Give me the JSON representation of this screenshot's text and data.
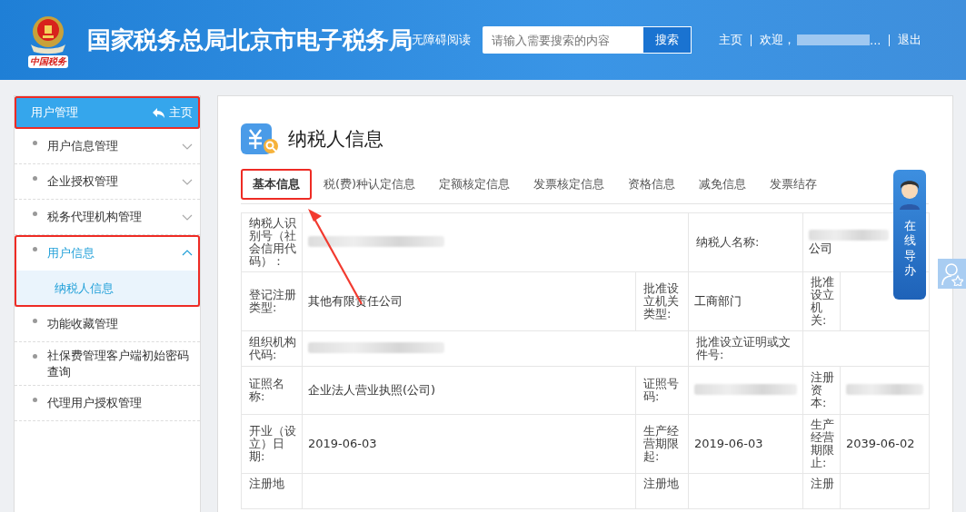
{
  "header": {
    "emblem_caption": "中国税务",
    "title": "国家税务总局北京市电子税务局",
    "accessibility": "无障碍阅读",
    "search": {
      "placeholder": "请输入需要搜索的内容",
      "button": "搜索"
    },
    "home": "主页",
    "welcome": "欢迎，",
    "ellipsis": "...",
    "logout": "退出"
  },
  "sidebar": {
    "title": "用户管理",
    "home": "主页",
    "items": [
      {
        "label": "用户信息管理",
        "kind": "group",
        "expanded": false
      },
      {
        "label": "企业授权管理",
        "kind": "group",
        "expanded": false
      },
      {
        "label": "税务代理机构管理",
        "kind": "group",
        "expanded": false
      },
      {
        "label": "用户信息",
        "kind": "group",
        "expanded": true,
        "children": [
          {
            "label": "纳税人信息",
            "selected": true
          }
        ]
      },
      {
        "label": "功能收藏管理",
        "kind": "link"
      },
      {
        "label": "社保费管理客户端初始密码查询",
        "kind": "link"
      },
      {
        "label": "代理用户授权管理",
        "kind": "link"
      }
    ]
  },
  "page": {
    "title": "纳税人信息",
    "tabs": [
      {
        "label": "基本信息",
        "selected": true
      },
      {
        "label": "税(费)种认定信息",
        "selected": false
      },
      {
        "label": "定额核定信息",
        "selected": false
      },
      {
        "label": "发票核定信息",
        "selected": false
      },
      {
        "label": "资格信息",
        "selected": false
      },
      {
        "label": "减免信息",
        "selected": false
      },
      {
        "label": "发票结存",
        "selected": false
      }
    ],
    "rows": [
      [
        {
          "kind": "label",
          "text": "纳税人识别号（社会信用代码）："
        },
        {
          "kind": "redacted",
          "colspan": 2
        },
        {
          "kind": "label",
          "text": "纳税人名称:"
        },
        {
          "kind": "partly_redacted",
          "text": "公司",
          "colspan": 2
        }
      ],
      [
        {
          "kind": "label",
          "text": "登记注册类型:"
        },
        {
          "kind": "value",
          "text": "其他有限责任公司"
        },
        {
          "kind": "label",
          "text": "批准设立机关类型:"
        },
        {
          "kind": "value",
          "text": "工商部门"
        },
        {
          "kind": "label",
          "text": "批准设立机关:"
        },
        {
          "kind": "value"
        }
      ],
      [
        {
          "kind": "label",
          "text": "组织机构代码:"
        },
        {
          "kind": "redacted",
          "colspan": 2
        },
        {
          "kind": "label",
          "text": "批准设立证明或文件号:"
        },
        {
          "kind": "value",
          "colspan": 2
        }
      ],
      [
        {
          "kind": "label",
          "text": "证照名称:"
        },
        {
          "kind": "value",
          "text": "企业法人营业执照(公司)"
        },
        {
          "kind": "label",
          "text": "证照号码:"
        },
        {
          "kind": "redacted"
        },
        {
          "kind": "label",
          "text": "注册资本:"
        },
        {
          "kind": "redacted"
        }
      ],
      [
        {
          "kind": "label",
          "text": "开业（设立）日期:"
        },
        {
          "kind": "value",
          "text": "2019-06-03"
        },
        {
          "kind": "label",
          "text": "生产经营期限起:"
        },
        {
          "kind": "value",
          "text": "2019-06-03"
        },
        {
          "kind": "label",
          "text": "生产经营期限止:"
        },
        {
          "kind": "value",
          "text": "2039-06-02"
        }
      ],
      [
        {
          "kind": "label",
          "text": "注册地"
        },
        {
          "kind": "value"
        },
        {
          "kind": "label",
          "text": "注册地"
        },
        {
          "kind": "value"
        },
        {
          "kind": "label",
          "text": "注册"
        },
        {
          "kind": "value"
        }
      ]
    ]
  },
  "guide": {
    "label": "在线导办"
  }
}
